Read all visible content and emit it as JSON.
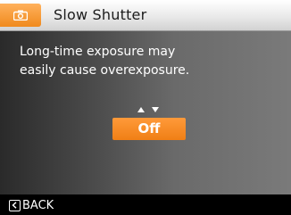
{
  "header": {
    "title": "Slow Shutter",
    "mode_icon": "camera-icon"
  },
  "message": "Long-time exposure may\neasily cause overexposure.",
  "option": {
    "value": "Off",
    "arrows_icon": "up-down-arrows-icon"
  },
  "footer": {
    "back_label": "BACK",
    "back_icon": "back-bracket-icon"
  },
  "colors": {
    "accent": "#f08a1d",
    "title_bar": "#e9e9e9",
    "background": "#4e4e4e",
    "text": "#ffffff"
  }
}
